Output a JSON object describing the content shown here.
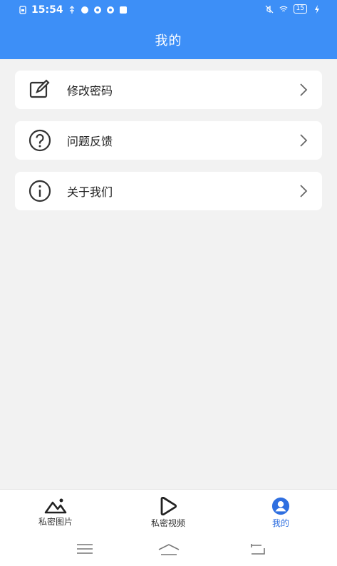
{
  "status_bar": {
    "time": "15:54",
    "battery_level": "15"
  },
  "header": {
    "title": "我的"
  },
  "menu": [
    {
      "label": "修改密码",
      "icon": "edit-icon"
    },
    {
      "label": "问题反馈",
      "icon": "question-icon"
    },
    {
      "label": "关于我们",
      "icon": "info-icon"
    }
  ],
  "tabs": [
    {
      "label": "私密图片",
      "icon": "mountain-icon",
      "active": false
    },
    {
      "label": "私密视频",
      "icon": "play-icon",
      "active": false
    },
    {
      "label": "我的",
      "icon": "profile-icon",
      "active": true
    }
  ],
  "colors": {
    "header_bg": "#3d8ff7",
    "page_bg": "#f2f2f2",
    "active_tab": "#2f6fe0"
  }
}
